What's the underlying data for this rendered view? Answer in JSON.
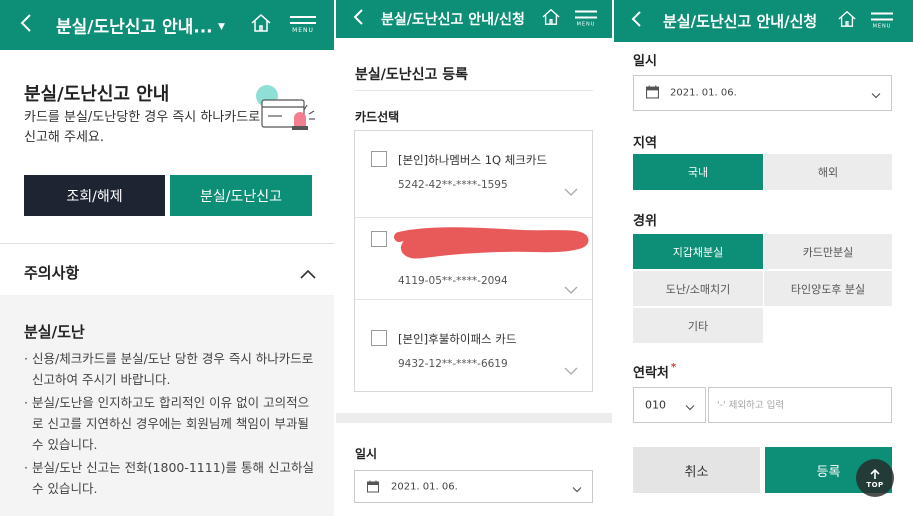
{
  "colors": {
    "brand": "#0c8e77",
    "dark_button": "#1f2433",
    "required": "#e0393e",
    "redaction": "#e85a5a"
  },
  "panel1": {
    "header": {
      "title": "분실/도난신고 안내...",
      "menu_label": "MENU"
    },
    "guide_title": "분실/도난신고 안내",
    "guide_desc": "카드를 분실/도난당한 경우 즉시 하나카드로 신고해 주세요.",
    "btn_inquiry": "조회/해제",
    "btn_report": "분실/도난신고",
    "caution": "주의사항",
    "lost_title": "분실/도난",
    "bullets": [
      "신용/체크카드를 분실/도난 당한 경우 즉시 하나카드로 신고하여 주시기 바랍니다.",
      "분실/도난을 인지하고도 합리적인 이유 없이 고의적으로 신고를 지연하신 경우에는 회원님께 책임이 부과될 수 있습니다.",
      "분실/도난 신고는 전화(1800-1111)를 통해 신고하실 수 있습니다."
    ]
  },
  "panel2": {
    "header": {
      "title": "분실/도난신고 안내/신청",
      "menu_label": "MENU"
    },
    "reg_title": "분실/도난신고 등록",
    "card_select": "카드선택",
    "cards": [
      {
        "name": "[본인]하나멤버스 1Q 체크카드",
        "number": "5242-42**-****-1595"
      },
      {
        "name": "",
        "number": "4119-05**-****-2094"
      },
      {
        "name": "[본인]후불하이패스 카드",
        "number": "9432-12**-****-6619"
      }
    ],
    "date_label": "일시",
    "date_value": "2021. 01. 06."
  },
  "panel3": {
    "header": {
      "title": "분실/도난신고 안내/신청",
      "menu_label": "MENU"
    },
    "date_label": "일시",
    "date_value": "2021. 01. 06.",
    "region_label": "지역",
    "region_options": [
      "국내",
      "해외"
    ],
    "reason_label": "경위",
    "reason_options": [
      "지갑채분실",
      "카드만분실",
      "도난/소매치기",
      "타인양도후 분실",
      "기타"
    ],
    "contact_label": "연락처",
    "contact_required": "*",
    "phone_prefix": "010",
    "phone_placeholder": "'-' 제외하고 입력",
    "btn_cancel": "취소",
    "btn_submit": "등록",
    "top_label": "TOP"
  }
}
